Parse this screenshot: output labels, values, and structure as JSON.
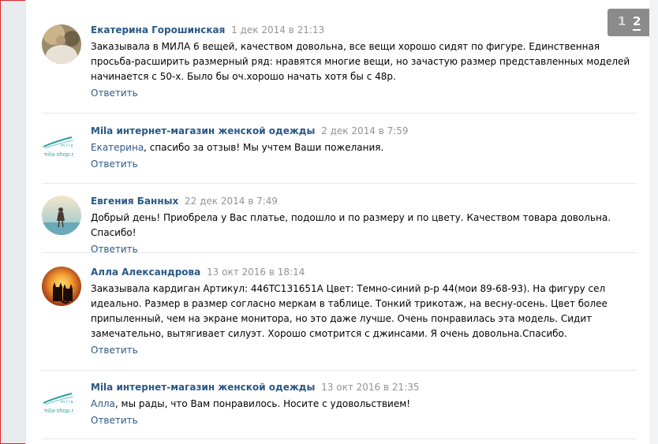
{
  "comments": [
    {
      "author": "Екатерина Горошинская",
      "date": "1 дек 2014 в 21:13",
      "text": "Заказывала в МИЛА 6 вещей, качеством довольна, все вещи хорошо сидят по фигуре. Единственная просьба-расширить размерный ряд: нравятся многие вещи, но зачастую размер представленных моделей начинается с 50-х. Было бы оч.хорошо начать хотя бы с 48р.",
      "reply_label": "Ответить"
    },
    {
      "author": "Mila интернет-магазин женской одежды",
      "date": "2 дек 2014 в 7:59",
      "mention": "Екатерина",
      "text": ", спасибо за отзыв! Мы учтем Ваши пожелания.",
      "reply_label": "Ответить",
      "logo_text": "mila-shop.r",
      "logo_word": "m i l a"
    },
    {
      "author": "Евгения Банных",
      "date": "22 дек 2014 в 7:49",
      "text": "Добрый день! Приобрела у Вас платье, подошло и по размеру и по цвету. Качеством товара довольна. Спасибо!",
      "reply_label": "Ответить"
    },
    {
      "author": "Алла Александрова",
      "date": "13 окт 2016 в 18:14",
      "text": "Заказывала кардиган Артикул: 446TC131651A Цвет: Темно-синий р-р 44(мои 89-68-93). На фигуру сел идеально. Размер в размер согласно меркам в таблице. Тонкий трикотаж, на весну-осень. Цвет более припыленный, чем на экране монитора, но это даже лучше. Очень понравилась эта модель. Сидит замечательно, вытягивает силуэт. Хорошо смотрится с джинсами. Я очень довольна.Спасибо.",
      "reply_label": "Ответить"
    },
    {
      "author": "Mila интернет-магазин женской одежды",
      "date": "13 окт 2016 в 21:35",
      "mention": "Алла",
      "text": ", мы рады, что Вам понравилось. Носите с удовольствием!",
      "reply_label": "Ответить",
      "logo_text": "mila-shop.r",
      "logo_word": "m i l a"
    }
  ],
  "pager": {
    "page1": "1",
    "page2": "2"
  }
}
